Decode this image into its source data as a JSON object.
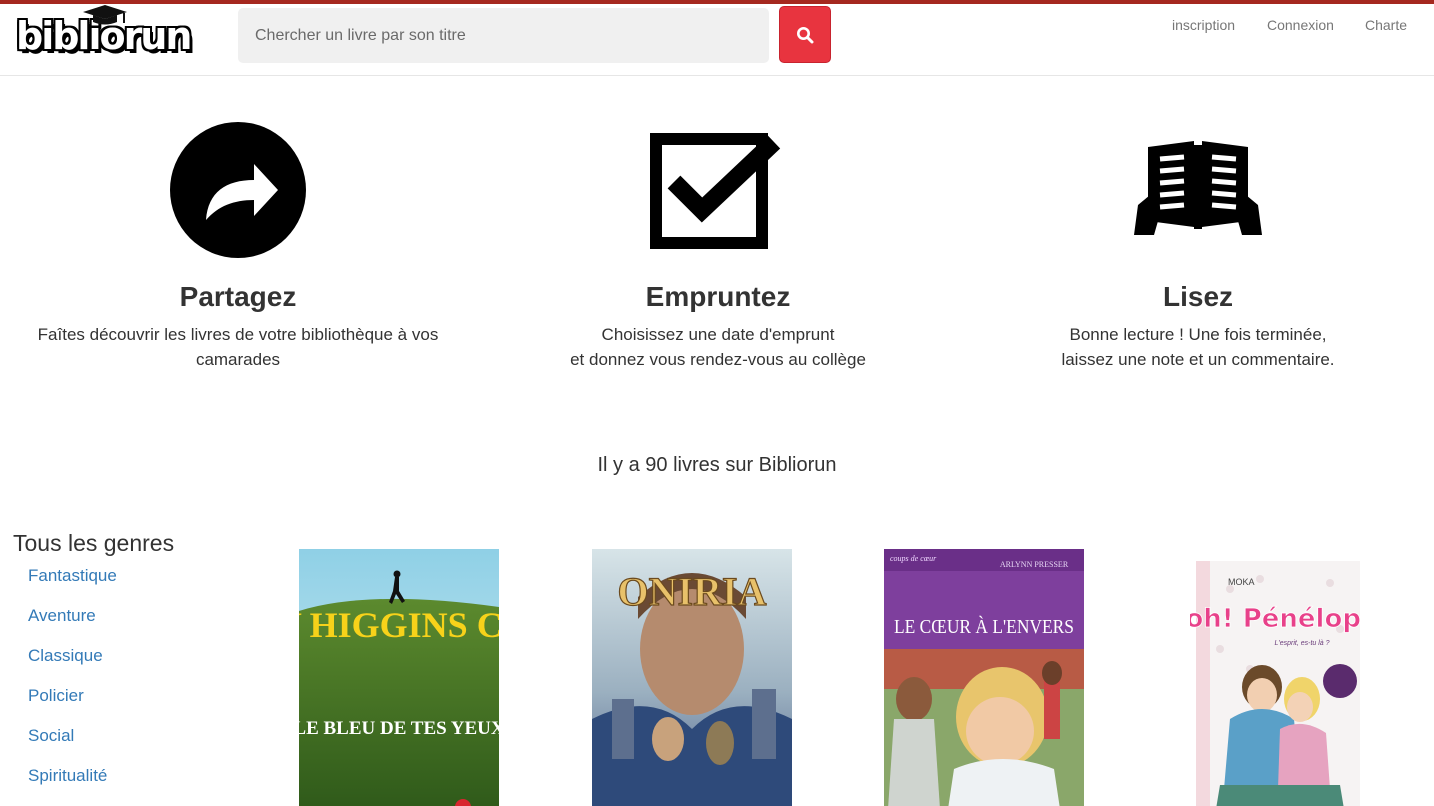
{
  "header": {
    "logo_text": "bibliorun",
    "search_placeholder": "Chercher un livre par son titre",
    "search_icon": "search-icon",
    "nav": [
      {
        "label": "inscription"
      },
      {
        "label": "Connexion"
      },
      {
        "label": "Charte"
      }
    ],
    "accent_color": "#e8343f",
    "top_bar_color": "#a5281f"
  },
  "features": [
    {
      "icon": "share-arrow-icon",
      "title": "Partagez",
      "line1": "Faîtes découvrir les livres de votre bibliothèque à vos",
      "line2": "camarades"
    },
    {
      "icon": "checkbox-checked-icon",
      "title": "Empruntez",
      "line1": "Choisissez une date d'emprunt",
      "line2": "et donnez vous rendez-vous au collège"
    },
    {
      "icon": "reading-book-icon",
      "title": "Lisez",
      "line1": "Bonne lecture ! Une fois terminée,",
      "line2": "laissez une note et un commentaire."
    }
  ],
  "book_count_text": "Il y a 90 livres sur Bibliorun",
  "genres": {
    "title": "Tous les genres",
    "items": [
      "Fantastique",
      "Aventure",
      "Classique",
      "Policier",
      "Social",
      "Spiritualité"
    ],
    "link_color": "#337ab7"
  },
  "books": [
    {
      "cover_title": "MARY HIGGINS CLARK",
      "cover_subtitle": "LE BLEU DE TES YEUX"
    },
    {
      "cover_title": "ONIRIA",
      "cover_subtitle": ""
    },
    {
      "cover_series": "coups de cœur",
      "cover_author": "ARLYNN PRESSER",
      "cover_title": "LE CŒUR À L'ENVERS"
    },
    {
      "cover_author": "MOKA",
      "cover_title": "oh! Pénélope",
      "cover_subtitle": "L'esprit, es-tu là ?"
    }
  ]
}
